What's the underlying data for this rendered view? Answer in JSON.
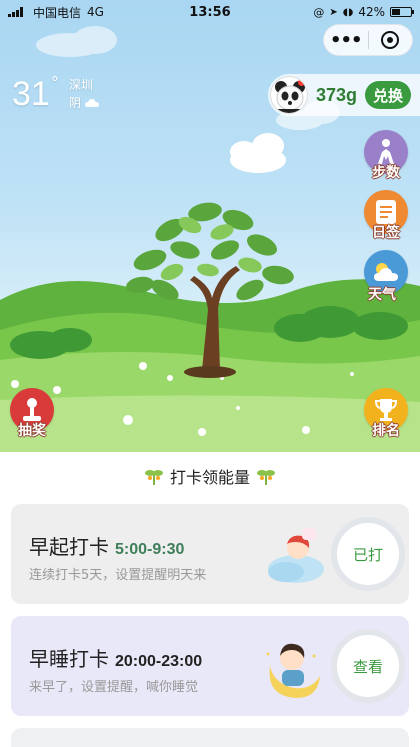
{
  "status_bar": {
    "carrier": "中国电信",
    "network": "4G",
    "time": "13:56",
    "battery": "42%",
    "battery_level": 0.42
  },
  "capsule": {
    "more_icon": "more-dots-icon",
    "close_icon": "target-close-icon"
  },
  "weather": {
    "temperature": "31",
    "degree_symbol": "°",
    "city": "深圳",
    "condition": "阴",
    "icon": "cloud-icon"
  },
  "energy": {
    "amount": "373g",
    "exchange_label": "兑换",
    "avatar_icon": "panda-avatar-icon"
  },
  "side_buttons": {
    "steps": "步数",
    "diary": "日签",
    "weather": "天气",
    "lottery": "抽奖",
    "ranking": "排名"
  },
  "section": {
    "title": "打卡领能量"
  },
  "cards": [
    {
      "title": "早起打卡",
      "time_range": "5:00-9:30",
      "description": "连续打卡5天，设置提醒明天来",
      "button": "已打",
      "time_color": "#3f7f5a",
      "bg": "#eeeeee"
    },
    {
      "title": "早睡打卡",
      "time_range": "20:00-23:00",
      "description": "来早了，设置提醒，喊你睡觉",
      "button": "查看",
      "time_color": "#222222",
      "bg": "#e9e8f8"
    }
  ],
  "colors": {
    "brand_green": "#3a9a3f",
    "steps_purple": "#9a7fc9",
    "diary_orange": "#f08a32",
    "weather_blue": "#4a9ad8",
    "lottery_red": "#d93b3b",
    "ranking_gold": "#f2b21d"
  }
}
